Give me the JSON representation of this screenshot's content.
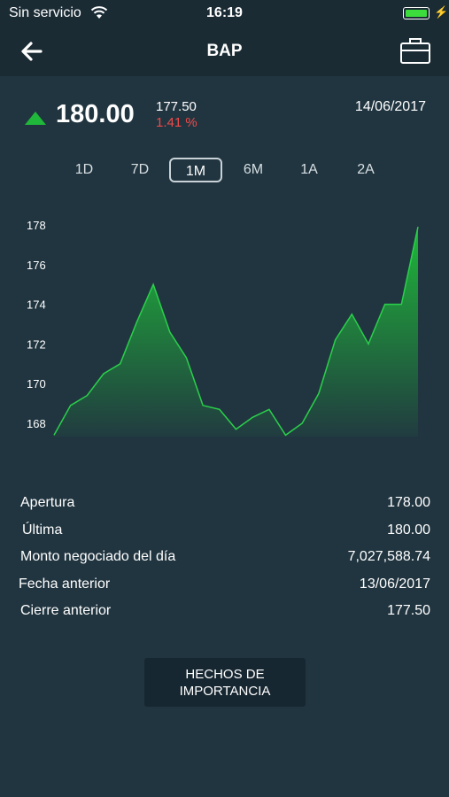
{
  "status_bar": {
    "carrier": "Sin servicio",
    "time": "16:19"
  },
  "nav": {
    "title": "BAP",
    "back_icon": "arrow-left-icon",
    "portfolio_icon": "briefcase-icon"
  },
  "quote": {
    "price": "180.00",
    "previous": "177.50",
    "change_pct": "1.41 %",
    "date": "14/06/2017",
    "direction": "up",
    "up_color": "#1fb83a",
    "change_color": "#ef4a4a"
  },
  "ranges": {
    "items": [
      "1D",
      "7D",
      "1M",
      "6M",
      "1A",
      "2A"
    ],
    "selected": "1M"
  },
  "chart_data": {
    "type": "area",
    "y_ticks": [
      "178",
      "176",
      "174",
      "172",
      "170",
      "168"
    ],
    "ylim": [
      167,
      178.5
    ],
    "grid": false,
    "values": [
      167.4,
      168.9,
      169.4,
      170.5,
      171.0,
      173.1,
      175.0,
      172.6,
      171.3,
      168.9,
      168.7,
      167.7,
      168.3,
      168.7,
      167.4,
      168.0,
      169.5,
      172.2,
      173.5,
      172.0,
      174.0,
      174.0,
      177.9
    ],
    "line_color": "#1fb83a"
  },
  "stats": [
    {
      "label": "Apertura",
      "value": "178.00"
    },
    {
      "label": "Última",
      "value": "180.00"
    },
    {
      "label": "Monto negociado del día",
      "value": "7,027,588.74"
    },
    {
      "label": "Fecha anterior",
      "value": "13/06/2017"
    },
    {
      "label": "Cierre anterior",
      "value": "177.50"
    }
  ],
  "button": {
    "label": "HECHOS DE IMPORTANCIA"
  }
}
